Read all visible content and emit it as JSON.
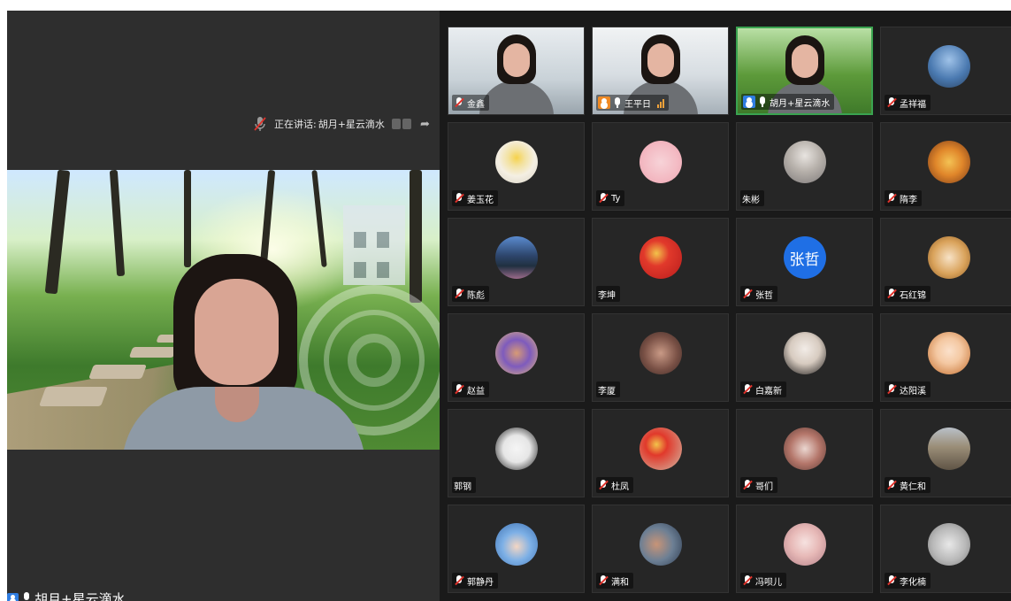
{
  "speaking": {
    "prefix": "正在讲话:",
    "name": "胡月+星云滴水"
  },
  "main_video": {
    "name": "胡月+星云滴水"
  },
  "participants": [
    {
      "name": "金鑫",
      "mic": "muted",
      "avatar": "camera-office",
      "badge": ""
    },
    {
      "name": "王平日",
      "mic": "on",
      "avatar": "camera-office",
      "badge": "host-orange",
      "signal": true
    },
    {
      "name": "胡月+星云滴水",
      "mic": "on",
      "avatar": "camera-forest",
      "badge": "host-blue",
      "active": true
    },
    {
      "name": "孟祥福",
      "mic": "muted",
      "avatar": "city-photo",
      "badge": ""
    },
    {
      "name": "姜玉花",
      "mic": "muted",
      "avatar": "flower-photo",
      "badge": ""
    },
    {
      "name": "Ty",
      "mic": "muted",
      "avatar": "pink-photo",
      "badge": ""
    },
    {
      "name": "朱彬",
      "mic": "none",
      "avatar": "person-photo",
      "badge": ""
    },
    {
      "name": "隋李",
      "mic": "muted",
      "avatar": "pagoda-photo",
      "badge": ""
    },
    {
      "name": "陈彪",
      "mic": "muted",
      "avatar": "landscape-photo",
      "badge": ""
    },
    {
      "name": "李坤",
      "mic": "none",
      "avatar": "flag-photo",
      "badge": ""
    },
    {
      "name": "张哲",
      "mic": "muted",
      "avatar": "text-avatar",
      "avatar_text": "张哲",
      "badge": ""
    },
    {
      "name": "石红锦",
      "mic": "muted",
      "avatar": "cartoon-girl",
      "badge": ""
    },
    {
      "name": "赵益",
      "mic": "muted",
      "avatar": "sunglasses-photo",
      "badge": ""
    },
    {
      "name": "李厦",
      "mic": "none",
      "avatar": "woman-photo",
      "badge": ""
    },
    {
      "name": "白嘉新",
      "mic": "muted",
      "avatar": "selfie-photo",
      "badge": ""
    },
    {
      "name": "达阳溪",
      "mic": "muted",
      "avatar": "cartoon-face",
      "badge": ""
    },
    {
      "name": "郭钢",
      "mic": "none",
      "avatar": "panda-photo",
      "badge": ""
    },
    {
      "name": "杜凤",
      "mic": "muted",
      "avatar": "flag-photo-2",
      "badge": ""
    },
    {
      "name": "哥们",
      "mic": "muted",
      "avatar": "child-photo",
      "badge": ""
    },
    {
      "name": "黄仁和",
      "mic": "muted",
      "avatar": "field-photo",
      "badge": ""
    },
    {
      "name": "郭静丹",
      "mic": "muted",
      "avatar": "heart-hands-photo",
      "badge": ""
    },
    {
      "name": "满和",
      "mic": "muted",
      "avatar": "man-photo",
      "badge": ""
    },
    {
      "name": "冯呗儿",
      "mic": "muted",
      "avatar": "girl-photo",
      "badge": ""
    },
    {
      "name": "李化楠",
      "mic": "muted",
      "avatar": "blur-photo",
      "badge": ""
    }
  ],
  "colors": {
    "background": "#2e2e2e",
    "grid_background": "#1a1a1a",
    "tile": "#262626",
    "active_border": "#3aa350",
    "host_orange": "#f08a24",
    "host_blue": "#2f7de1",
    "muted_red": "#e0322b",
    "text_avatar_bg": "#1f6fe5"
  }
}
